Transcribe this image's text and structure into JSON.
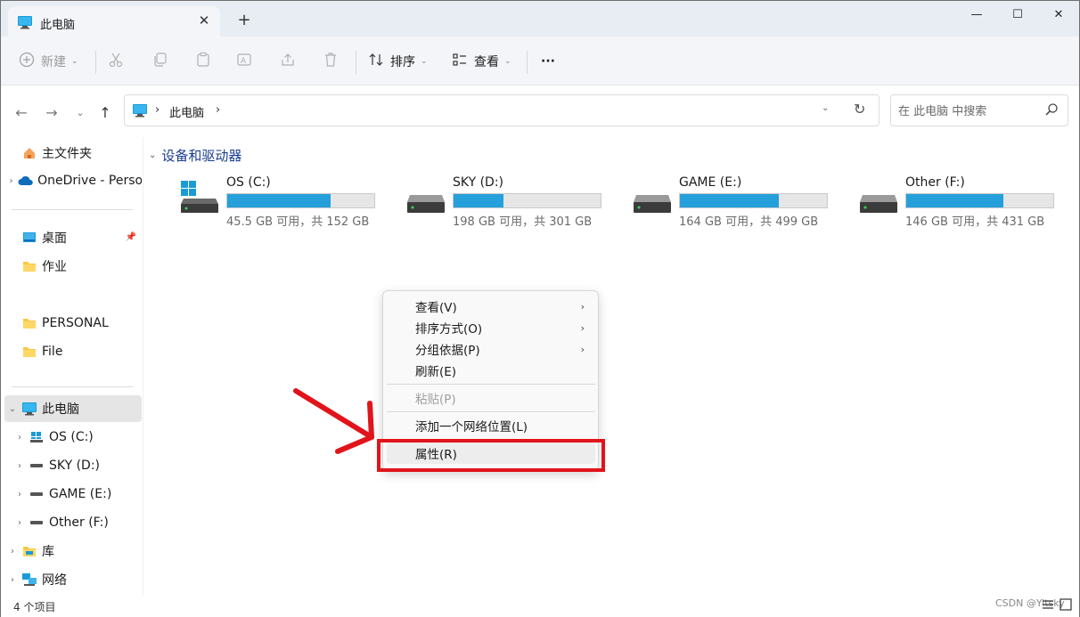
{
  "window": {
    "tab_title": "此电脑",
    "tab_close": "✕",
    "tab_add": "+",
    "minimize": "—",
    "maximize": "☐",
    "close": "✕"
  },
  "toolbar": {
    "new_label": "新建",
    "sort_label": "排序",
    "view_label": "查看",
    "more_label": "···"
  },
  "address": {
    "path": "此电脑",
    "search_placeholder": "在 此电脑 中搜索"
  },
  "sidebar": {
    "items": [
      {
        "label": "主文件夹"
      },
      {
        "label": "OneDrive - Personal"
      },
      {
        "label": "桌面"
      },
      {
        "label": "作业"
      },
      {
        "label": "PERSONAL"
      },
      {
        "label": "File"
      },
      {
        "label": "此电脑"
      },
      {
        "label": "OS (C:)"
      },
      {
        "label": "SKY (D:)"
      },
      {
        "label": "GAME (E:)"
      },
      {
        "label": "Other (F:)"
      },
      {
        "label": "库"
      },
      {
        "label": "网络"
      }
    ]
  },
  "content": {
    "section_title": "设备和驱动器",
    "drives": [
      {
        "name": "OS (C:)",
        "space": "45.5 GB 可用，共 152 GB",
        "used_fraction": 0.7
      },
      {
        "name": "SKY (D:)",
        "space": "198 GB 可用，共 301 GB",
        "used_fraction": 0.34
      },
      {
        "name": "GAME (E:)",
        "space": "164 GB 可用，共 499 GB",
        "used_fraction": 0.67
      },
      {
        "name": "Other (F:)",
        "space": "146 GB 可用，共 431 GB",
        "used_fraction": 0.66
      }
    ]
  },
  "context_menu": {
    "items": [
      {
        "label": "查看(V)"
      },
      {
        "label": "排序方式(O)"
      },
      {
        "label": "分组依据(P)"
      },
      {
        "label": "刷新(E)"
      },
      {
        "label": "粘贴(P)"
      },
      {
        "label": "添加一个网络位置(L)"
      },
      {
        "label": "属性(R)"
      }
    ]
  },
  "status": {
    "item_count": "4 个项目",
    "watermark": "CSDN @Yitsky"
  },
  "colors": {
    "accent": "#26a0da",
    "highlight": "#e0141a",
    "titlebar": "#e8edf4"
  }
}
